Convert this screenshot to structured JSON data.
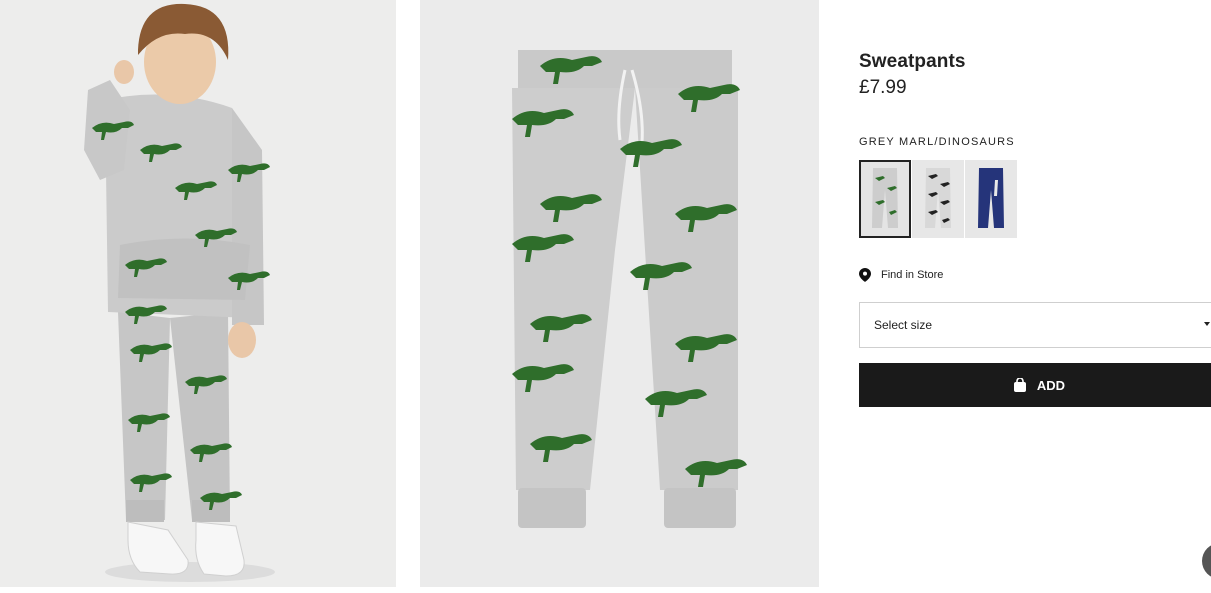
{
  "product": {
    "title": "Sweatpants",
    "price": "£7.99",
    "color_name": "GREY MARL/DINOSAURS"
  },
  "swatches": [
    {
      "label": "grey-marl-dinosaurs",
      "selected": true,
      "color": "#cdcdcd"
    },
    {
      "label": "light-grey-black-pattern",
      "selected": false,
      "color": "#d8d8d8"
    },
    {
      "label": "dark-blue",
      "selected": false,
      "color": "#25347a"
    }
  ],
  "find_store": {
    "label": "Find in Store",
    "icon": "location-pin-icon"
  },
  "size_select": {
    "placeholder": "Select size",
    "icon": "chevron-down-icon"
  },
  "add_button": {
    "label": "ADD",
    "icon": "shopping-bag-icon"
  },
  "colors": {
    "accent": "#1a1a1a",
    "fabric_grey": "#c9c9c9",
    "dino_green": "#2e6b2a"
  }
}
